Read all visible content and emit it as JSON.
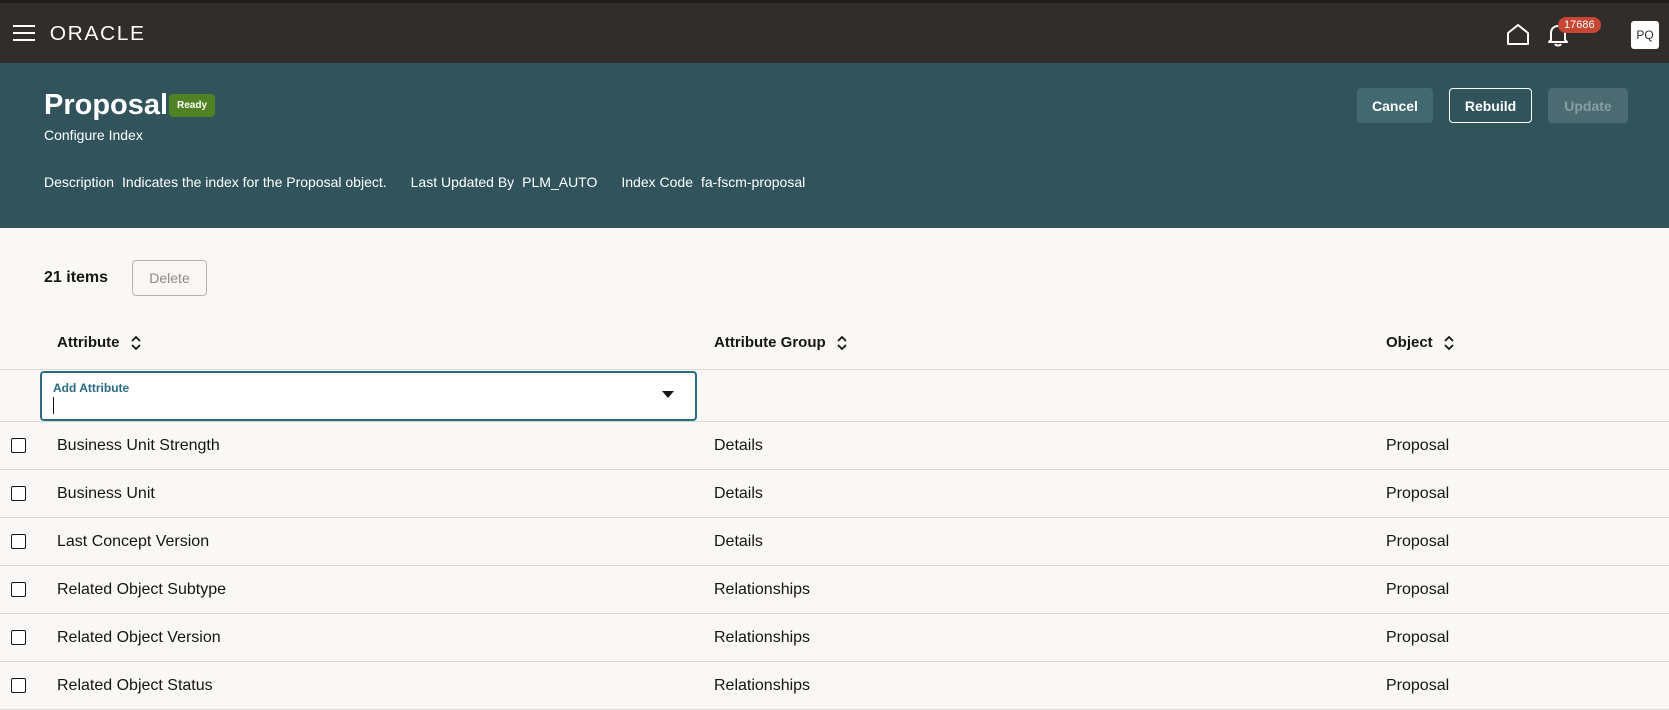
{
  "topbar": {
    "logo": "ORACLE",
    "notification_count": "17686",
    "avatar_initials": "PQ",
    "icons": [
      "menu-icon",
      "home-icon",
      "bell-icon"
    ]
  },
  "header": {
    "title": "Proposal",
    "status": "Ready",
    "subtitle": "Configure Index",
    "description_label": "Description",
    "description_value": "Indicates the index for the Proposal object.",
    "last_updated_label": "Last Updated By",
    "last_updated_value": "PLM_AUTO",
    "index_code_label": "Index Code",
    "index_code_value": "fa-fscm-proposal",
    "buttons": {
      "cancel": "Cancel",
      "rebuild": "Rebuild",
      "update": "Update"
    },
    "colors": {
      "header_bg": "#31545c",
      "topbar_bg": "#312d2a",
      "badge_bg": "#508223"
    }
  },
  "toolbar": {
    "items_count": "21 items",
    "delete_label": "Delete"
  },
  "table": {
    "columns": [
      "Attribute",
      "Attribute Group",
      "Object"
    ],
    "add_field_label": "Add Attribute",
    "rows": [
      {
        "attribute": "Business Unit Strength",
        "group": "Details",
        "object": "Proposal"
      },
      {
        "attribute": "Business Unit",
        "group": "Details",
        "object": "Proposal"
      },
      {
        "attribute": "Last Concept Version",
        "group": "Details",
        "object": "Proposal"
      },
      {
        "attribute": "Related Object Subtype",
        "group": "Relationships",
        "object": "Proposal"
      },
      {
        "attribute": "Related Object Version",
        "group": "Relationships",
        "object": "Proposal"
      },
      {
        "attribute": "Related Object Status",
        "group": "Relationships",
        "object": "Proposal"
      }
    ]
  }
}
